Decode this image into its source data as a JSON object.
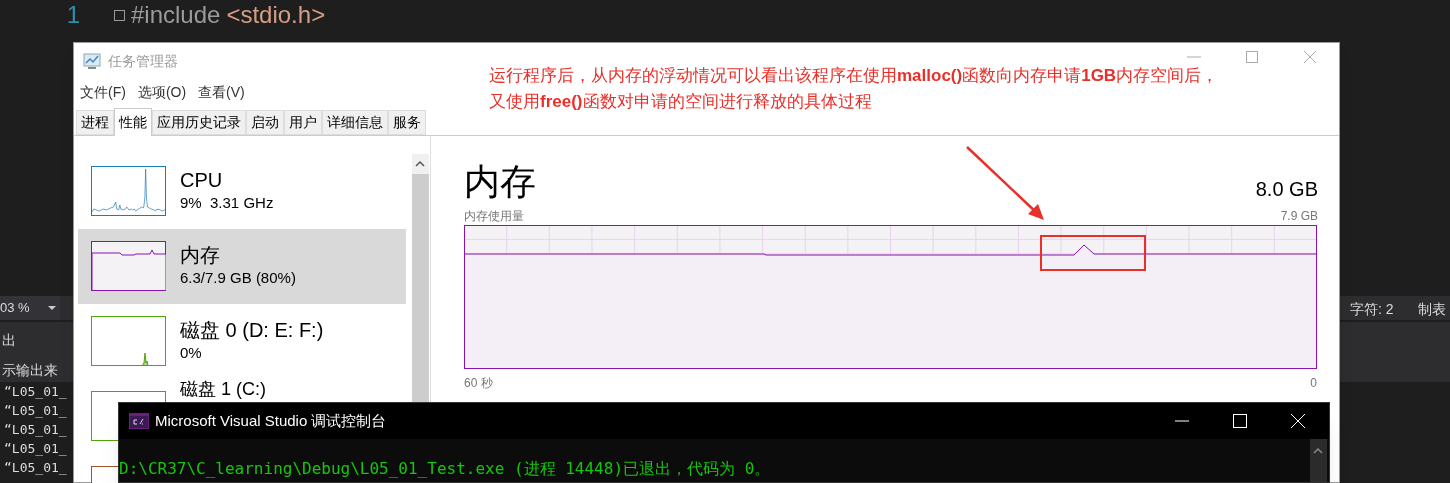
{
  "editor": {
    "line_numbers": [
      "1"
    ],
    "code_line": {
      "directive": "#include",
      "header": "<stdio.h>"
    },
    "status_bar": {
      "zoom": "03 %",
      "chars": "字符: 2",
      "tab": "制表"
    }
  },
  "output_panel": {
    "title": "出",
    "source_label": "示输出来",
    "lines": [
      "“L05_01_",
      "“L05_01_",
      "“L05_01_",
      "“L05_01_",
      "“L05_01_"
    ]
  },
  "task_manager": {
    "title": "任务管理器",
    "menu": [
      "文件(F)",
      "选项(O)",
      "查看(V)"
    ],
    "tabs": [
      {
        "label": "进程",
        "selected": false
      },
      {
        "label": "性能",
        "selected": true
      },
      {
        "label": "应用历史记录",
        "selected": false
      },
      {
        "label": "启动",
        "selected": false
      },
      {
        "label": "用户",
        "selected": false
      },
      {
        "label": "详细信息",
        "selected": false
      },
      {
        "label": "服务",
        "selected": false
      }
    ],
    "annotation": [
      "运行程序后，从内存的浮动情况可以看出该程序在使用**malloc()**函数向内存申请**1GB**内存空间后，",
      "又使用**free()**函数对申请的空间进行释放的具体过程"
    ],
    "resources": [
      {
        "kind": "cpu",
        "name": "CPU",
        "detail": "9%  3.31 GHz",
        "color": "#1c7ab8",
        "selected": false
      },
      {
        "kind": "memory",
        "name": "内存",
        "detail": "6.3/7.9 GB (80%)",
        "color": "#8b12ae",
        "selected": true
      },
      {
        "kind": "disk",
        "name": "磁盘 0 (D: E: F:)",
        "detail": "0%",
        "color": "#4da60c",
        "selected": false
      },
      {
        "kind": "disk_idle",
        "name": "磁盘 1 (C:)",
        "color": "#4da60c",
        "selected": false
      },
      {
        "kind": "blank",
        "color": "#a0522d",
        "selected": false
      }
    ],
    "detail": {
      "title": "内存",
      "total": "8.0 GB",
      "usage_label": "内存使用量",
      "max": "7.9 GB",
      "time_start": "60 秒",
      "time_end": "0"
    }
  },
  "console": {
    "title": "Microsoft Visual Studio 调试控制台",
    "lines": [
      "D:\\CR37\\C_learning\\Debug\\L05_01_Test.exe (进程 14448)已退出，代码为 0。"
    ]
  }
}
